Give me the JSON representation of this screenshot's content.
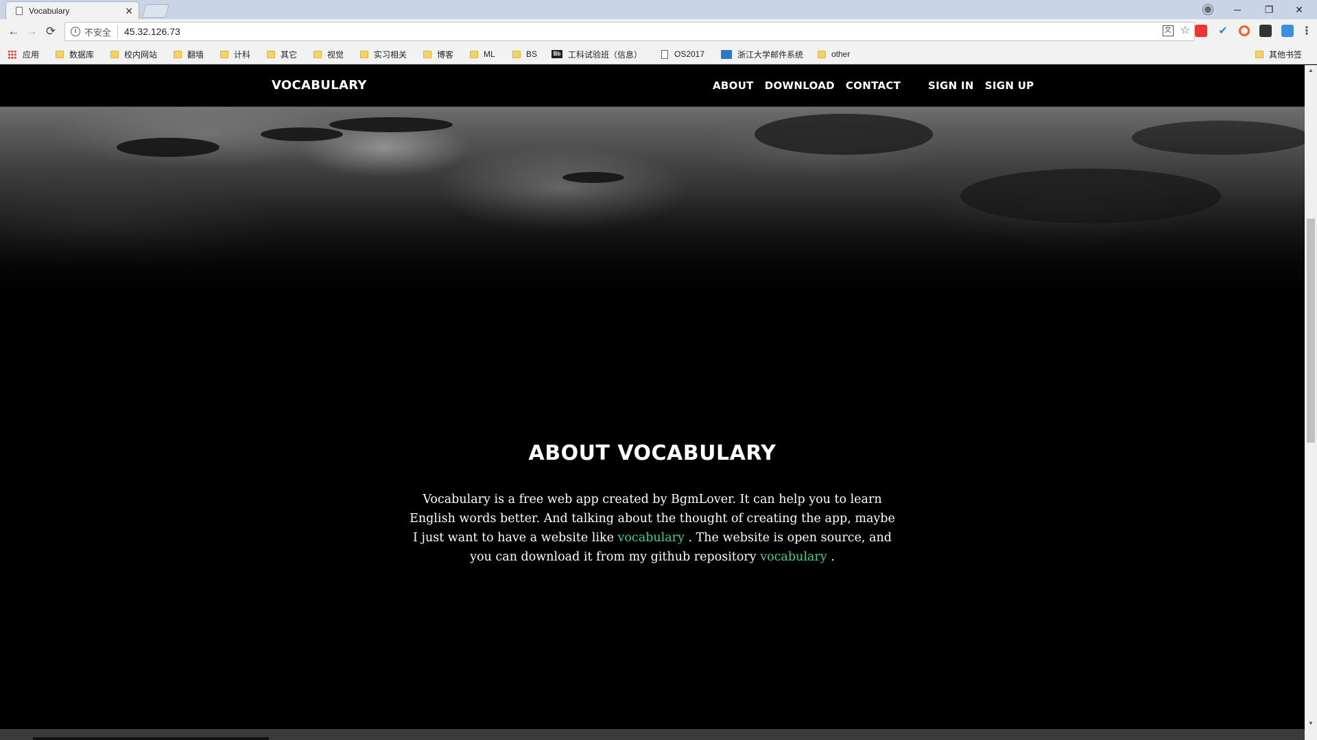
{
  "browser": {
    "tab_title": "Vocabulary",
    "tab_close": "✕",
    "security_label": "不安全",
    "url": "45.32.126.73",
    "window_controls": {
      "minimize": "─",
      "maximize": "❐",
      "close": "✕"
    },
    "nav": {
      "back": "←",
      "forward": "→",
      "reload": "⟳"
    },
    "star": "☆",
    "menu_dots": "⋮",
    "bookmarks": [
      {
        "label": "应用",
        "icon": "apps-grid-icon"
      },
      {
        "label": "数据库",
        "icon": "folder-icon"
      },
      {
        "label": "校内网站",
        "icon": "folder-icon"
      },
      {
        "label": "翻墙",
        "icon": "folder-icon"
      },
      {
        "label": "计科",
        "icon": "folder-icon"
      },
      {
        "label": "其它",
        "icon": "folder-icon"
      },
      {
        "label": "视觉",
        "icon": "folder-icon"
      },
      {
        "label": "实习相关",
        "icon": "folder-icon"
      },
      {
        "label": "博客",
        "icon": "folder-icon"
      },
      {
        "label": "ML",
        "icon": "folder-icon"
      },
      {
        "label": "BS",
        "icon": "folder-icon"
      },
      {
        "label": "工科试验班（信息）",
        "icon": "bb-icon"
      },
      {
        "label": "OS2017",
        "icon": "page-icon"
      },
      {
        "label": "浙江大学邮件系统",
        "icon": "mail-icon"
      },
      {
        "label": "other",
        "icon": "folder-icon"
      }
    ],
    "other_bookmarks": "其他书签"
  },
  "site": {
    "brand": "VOCABULARY",
    "nav_main": [
      "ABOUT",
      "DOWNLOAD",
      "CONTACT"
    ],
    "nav_auth": [
      "SIGN IN",
      "SIGN UP"
    ],
    "about": {
      "title": "ABOUT VOCABULARY",
      "text_1": "Vocabulary is a free web app created by BgmLover. It can help you to learn English words better. And talking about the thought of creating the app, maybe I just want to have a website like ",
      "link_1": "vocabulary",
      "text_2": " . The website is open source, and you can download it from my github repository ",
      "link_2": "vocabulary",
      "text_3": " ."
    }
  },
  "colors": {
    "link": "#3fd18a",
    "page_bg": "#000000",
    "chrome_bg": "#f2f2f2",
    "titlebar_bg": "#c9d4e6"
  }
}
